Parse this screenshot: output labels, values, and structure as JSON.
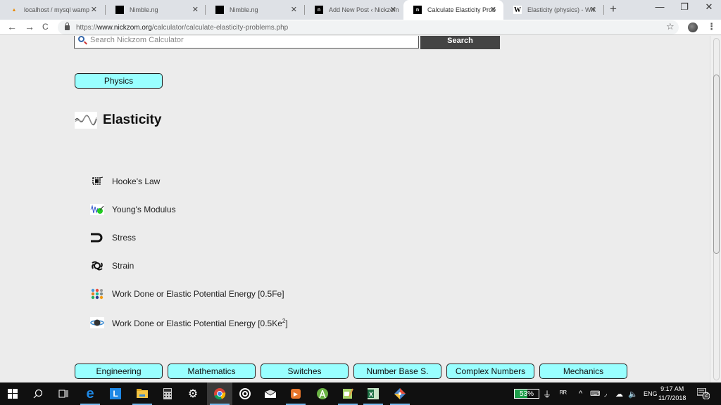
{
  "browser": {
    "tabs": [
      {
        "title": "localhost / mysql wamp",
        "favicon": "phpmyadmin-icon",
        "active": false
      },
      {
        "title": "Nimble.ng",
        "favicon": "black-square-icon",
        "active": false
      },
      {
        "title": "Nimble.ng",
        "favicon": "black-square-icon",
        "active": false
      },
      {
        "title": "Add New Post ‹ Nickzom",
        "favicon": "nickzom-icon",
        "active": false
      },
      {
        "title": "Calculate Elasticity Prob",
        "favicon": "nickzom-icon",
        "active": true
      },
      {
        "title": "Elasticity (physics) - Wik",
        "favicon": "wikipedia-icon",
        "active": false
      }
    ],
    "new_tab_symbol": "+",
    "window_controls": {
      "minimize": "—",
      "restore": "❐",
      "close": "✕"
    },
    "tab_close_symbol": "✕",
    "nav": {
      "back": "←",
      "forward": "→",
      "reload": "C"
    },
    "url": {
      "scheme": "https://",
      "host": "www.nickzom.org",
      "path": "/calculator/calculate-elasticity-problems.php"
    },
    "star_symbol": "☆",
    "menu_symbol": "⋮"
  },
  "page": {
    "search": {
      "placeholder": "Search Nickzom Calculator",
      "button_label": "Search"
    },
    "category_button": "Physics",
    "heading": "Elasticity",
    "items": [
      {
        "label": "Hooke's Law",
        "icon": "hookes-law-icon"
      },
      {
        "label": "Young's Modulus",
        "icon": "youngs-modulus-icon"
      },
      {
        "label": "Stress",
        "icon": "stress-magnet-icon"
      },
      {
        "label": "Strain",
        "icon": "strain-icon"
      },
      {
        "label": "Work Done or Elastic Potential Energy [0.5Fe]",
        "icon": "dots-grid-icon"
      },
      {
        "label_prefix": "Work Done or Elastic Potential Energy [0.5Ke",
        "label_sup": "2",
        "label_suffix": "]",
        "icon": "planet-icon"
      }
    ],
    "bottom_categories": [
      "Engineering",
      "Mathematics",
      "Switches",
      "Number Base S.",
      "Complex Numbers",
      "Mechanics"
    ]
  },
  "taskbar": {
    "apps": [
      "start",
      "search",
      "task-view",
      "edge",
      "l-app",
      "file-explorer",
      "calculator",
      "settings",
      "chrome",
      "groove",
      "mail",
      "media-player",
      "android-studio",
      "notepad",
      "excel",
      "git"
    ],
    "battery_percent": "53%",
    "language": "ENG",
    "time": "9:17 AM",
    "date": "11/7/2018",
    "notification_count": "2"
  }
}
